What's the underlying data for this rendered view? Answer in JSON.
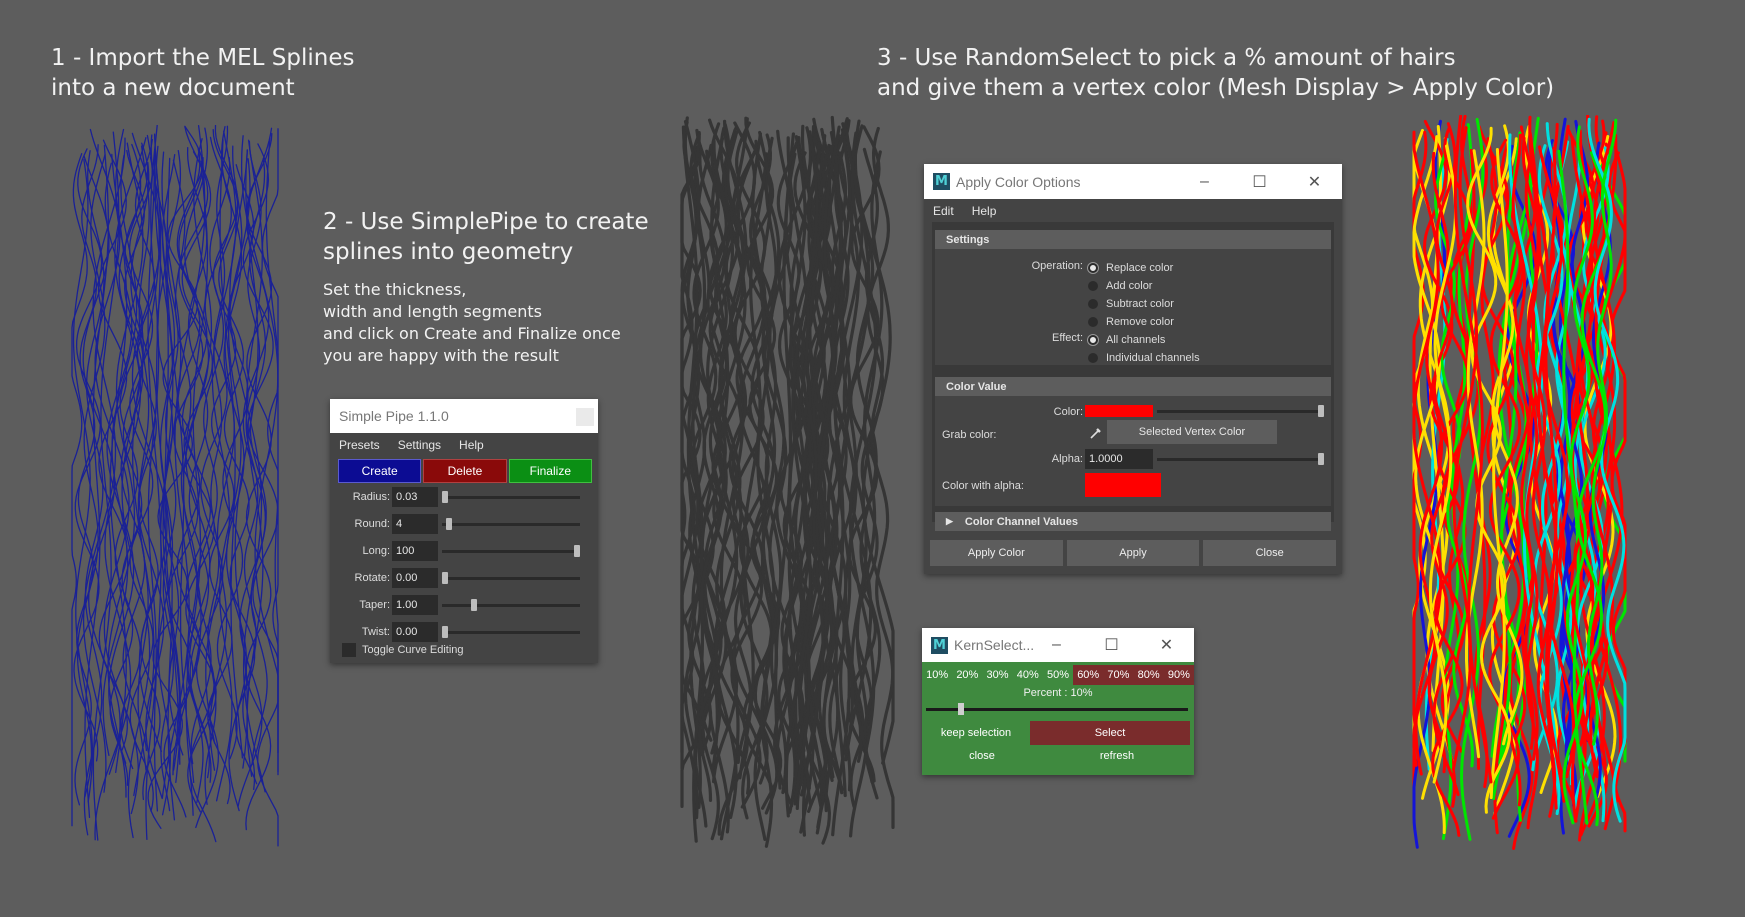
{
  "headings": {
    "step1": [
      "1 - Import the MEL Splines",
      "into a new document"
    ],
    "step2": [
      "2 - Use SimplePipe to create",
      "splines into geometry"
    ],
    "step2_body": [
      "Set the thickness,",
      "width and length segments",
      "and click on Create and Finalize once",
      "you are happy with the result"
    ],
    "step3": [
      "3 - Use RandomSelect to pick a % amount of hairs",
      "and give them a vertex color (Mesh Display > Apply Color)"
    ]
  },
  "colors": {
    "background": "#5d5d5d",
    "spline_blue": "#1a2196",
    "pipe_gray": "#353535",
    "create_btn": "#0c0c93",
    "delete_btn": "#8a0a0a",
    "finalize_btn": "#0b8f14",
    "kern_bg": "#3f8a3f",
    "kern_red": "#7a2c2c",
    "swatch_red": "#ff0000"
  },
  "simple_pipe": {
    "title": "Simple Pipe 1.1.0",
    "menu": [
      "Presets",
      "Settings",
      "Help"
    ],
    "buttons": {
      "create": "Create",
      "delete": "Delete",
      "finalize": "Finalize"
    },
    "params": [
      {
        "label": "Radius:",
        "value": "0.03",
        "pos": 0.0
      },
      {
        "label": "Round:",
        "value": "4",
        "pos": 0.03
      },
      {
        "label": "Long:",
        "value": "100",
        "pos": 1.0
      },
      {
        "label": "Rotate:",
        "value": "0.00",
        "pos": 0.0
      },
      {
        "label": "Taper:",
        "value": "1.00",
        "pos": 0.22
      },
      {
        "label": "Twist:",
        "value": "0.00",
        "pos": 0.0
      }
    ],
    "toggle_label": "Toggle Curve Editing"
  },
  "apply_color": {
    "title": "Apply Color Options",
    "menu": [
      "Edit",
      "Help"
    ],
    "settings_header": "Settings",
    "operation_label": "Operation:",
    "operations": [
      "Replace color",
      "Add color",
      "Subtract color",
      "Remove color"
    ],
    "effect_label": "Effect:",
    "effects": [
      "All channels",
      "Individual channels"
    ],
    "color_value_header": "Color Value",
    "color_label": "Color:",
    "grab_label": "Grab color:",
    "grab_button": "Selected Vertex Color",
    "alpha_label": "Alpha:",
    "alpha_value": "1.0000",
    "color_with_alpha_label": "Color with alpha:",
    "channel_values_header": "Color Channel Values",
    "buttons": [
      "Apply Color",
      "Apply",
      "Close"
    ]
  },
  "kern_select": {
    "title": "KernSelect...",
    "percents": [
      "10%",
      "20%",
      "30%",
      "40%",
      "50%",
      "60%",
      "70%",
      "80%",
      "90%"
    ],
    "percent_text": "Percent : 10%",
    "percent_value": 0.1,
    "keep_selection": "keep selection",
    "select": "Select",
    "close": "close",
    "refresh": "refresh"
  }
}
